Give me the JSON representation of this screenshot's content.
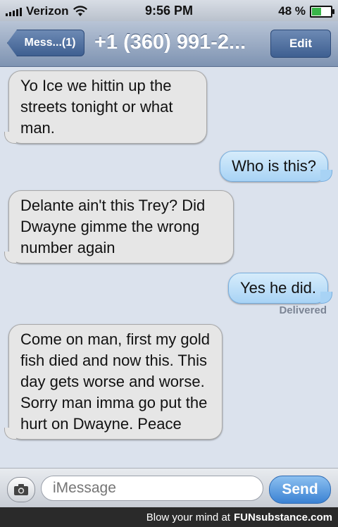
{
  "status_bar": {
    "carrier": "Verizon",
    "time": "9:56 PM",
    "battery": "48 %",
    "battery_level": 0.48
  },
  "nav": {
    "back_label": "Mess...(1)",
    "title": "+1 (360) 991-2...",
    "edit_label": "Edit"
  },
  "messages": [
    {
      "from": "them",
      "text": "Yo Ice we hittin up the streets tonight or what man."
    },
    {
      "from": "me",
      "text": "Who is this?"
    },
    {
      "from": "them",
      "text": "Delante ain't this Trey? Did Dwayne gimme the wrong number again"
    },
    {
      "from": "me",
      "text": "Yes he did."
    },
    {
      "from": "them",
      "text": "Come on man, first my gold fish died and now this. This day gets worse and worse. Sorry man imma go put the hurt on Dwayne. Peace"
    }
  ],
  "delivered_label": "Delivered",
  "compose": {
    "placeholder": "iMessage",
    "send_label": "Send"
  },
  "footer": {
    "text": "Blow your mind at",
    "brand": "FUNsubstance.com"
  },
  "colors": {
    "received": "#e6e6e6",
    "sent": "#a8d3f5",
    "nav": "#7e93b2",
    "background": "#dbe2ed"
  },
  "icons": [
    "signal-icon",
    "wifi-icon",
    "battery-icon",
    "camera-icon"
  ]
}
